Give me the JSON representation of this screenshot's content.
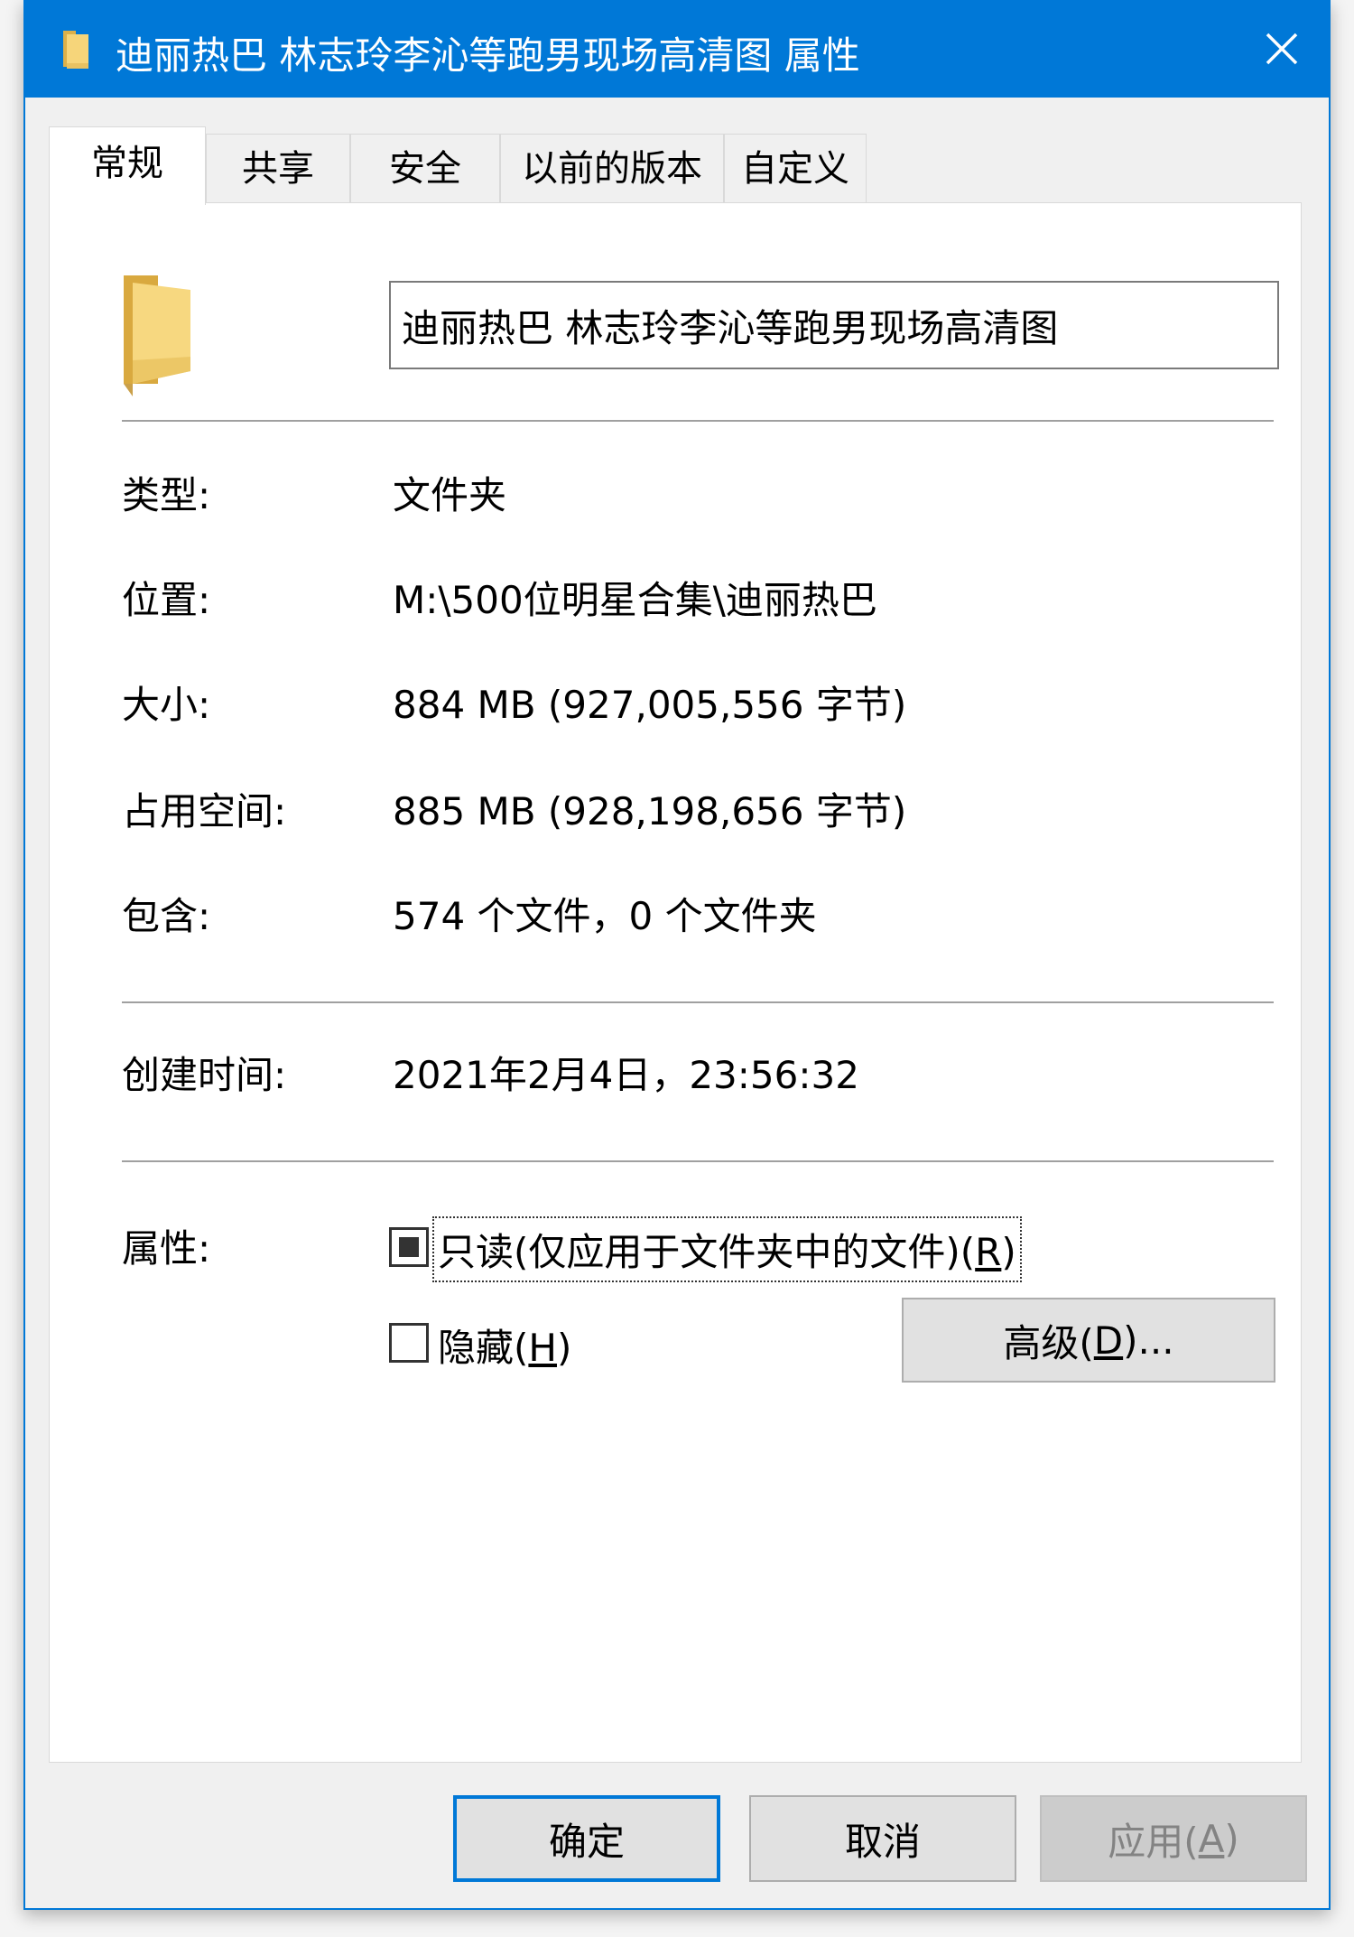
{
  "window": {
    "title": "迪丽热巴 林志玲李沁等跑男现场高清图 属性",
    "accent_color": "#0078d7",
    "title_icon": "folder-icon",
    "close_icon": "close-icon"
  },
  "tabs": [
    {
      "label": "常规",
      "active": true
    },
    {
      "label": "共享",
      "active": false
    },
    {
      "label": "安全",
      "active": false
    },
    {
      "label": "以前的版本",
      "active": false
    },
    {
      "label": "自定义",
      "active": false
    }
  ],
  "general": {
    "folder_icon": "folder-icon",
    "name_value": "迪丽热巴 林志玲李沁等跑男现场高清图",
    "type_label": "类型:",
    "type_value": "文件夹",
    "location_label": "位置:",
    "location_value": "M:\\500位明星合集\\迪丽热巴",
    "size_label": "大小:",
    "size_value": "884 MB (927,005,556 字节)",
    "disk_size_label": "占用空间:",
    "disk_size_value": "885 MB (928,198,656 字节)",
    "contains_label": "包含:",
    "contains_value": "574 个文件，0 个文件夹",
    "created_label": "创建时间:",
    "created_value": "2021年2月4日，23:56:32",
    "attributes_label": "属性:",
    "readonly_text": "只读(仅应用于文件夹中的文件)(",
    "readonly_key": "R",
    "readonly_close": ")",
    "readonly_state": "indeterminate",
    "hidden_text": "隐藏(",
    "hidden_key": "H",
    "hidden_close": ")",
    "hidden_checked": false,
    "advanced_text": "高级(",
    "advanced_key": "D",
    "advanced_close": ")..."
  },
  "footer": {
    "ok_label": "确定",
    "cancel_label": "取消",
    "apply_text": "应用(",
    "apply_key": "A",
    "apply_close": ")"
  }
}
